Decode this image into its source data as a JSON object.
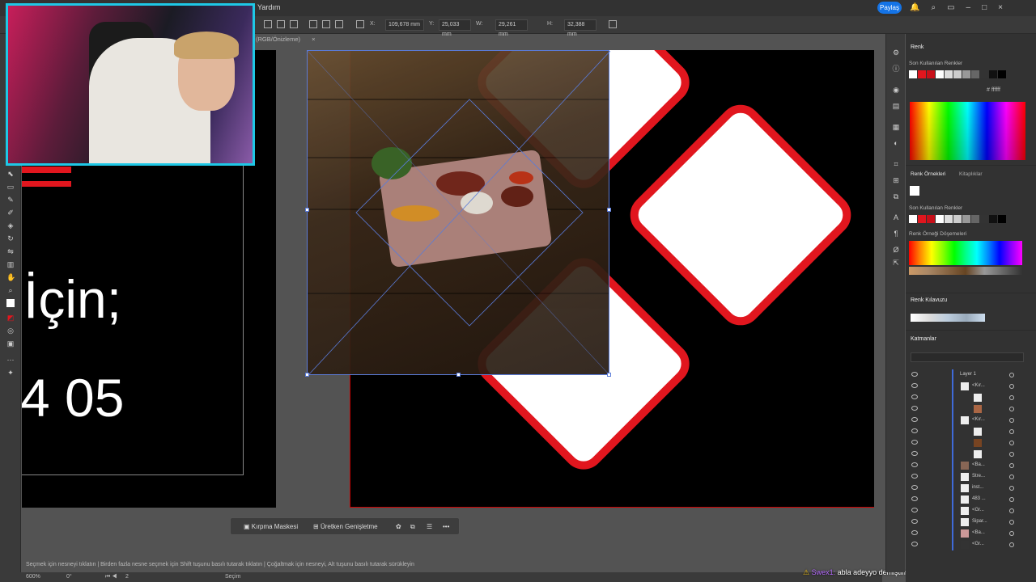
{
  "menubar": {
    "menu_label": "Yardım",
    "share_label": "Paylaş"
  },
  "control": {
    "x_label": "X:",
    "x_value": "109,678 mm",
    "y_label": "Y:",
    "y_value": "25,033 mm",
    "w_label": "W:",
    "w_value": "29,261 mm",
    "h_label": "H:",
    "h_value": "32,388 mm"
  },
  "doc_tab": {
    "label": "(RGB/Önizleme)",
    "close": "×"
  },
  "canvas": {
    "text_line1": "İçin;",
    "text_line2": "4 05"
  },
  "taskbar": {
    "clip_mask": "Kırpma Maskesi",
    "gen_expand": "Üretken Genişletme",
    "more": "•••"
  },
  "status": {
    "hint": "Seçmek için nesneyi tıklatın  |  Birden fazla nesne seçmek için Shift tuşunu basılı tutarak tıklatın  |  Çoğaltmak için nesneyi, Alt tuşunu basılı tutarak sürükleyin",
    "zoom": "600%",
    "rotation": "0°",
    "artboard_num": "2",
    "tool_name": "Seçim"
  },
  "chat": {
    "user": "Swex1:",
    "message": "abla adeyyo demiştim heralde kaydırma oldu"
  },
  "color_panel": {
    "title": "Renk",
    "recent_label": "Son Kullanılan Renkler",
    "hex_label": "#",
    "hex_value": "ffffff"
  },
  "swatches_panel": {
    "tab_active": "Renk Örnekleri",
    "tab_other": "Kitaplıklar",
    "recent_label": "Son Kullanılan Renkler",
    "library_label": "Renk Örneği Döşemeleri"
  },
  "guide_panel": {
    "title": "Renk Kılavuzu"
  },
  "layers_panel": {
    "title": "Katmanlar",
    "search_placeholder": "",
    "rows": [
      {
        "name": "Layer 1"
      },
      {
        "name": "<Kır..."
      },
      {
        "name": ""
      },
      {
        "name": ""
      },
      {
        "name": "<Kır..."
      },
      {
        "name": ""
      },
      {
        "name": ""
      },
      {
        "name": ""
      },
      {
        "name": "<Ba..."
      },
      {
        "name": "Stre..."
      },
      {
        "name": "inst..."
      },
      {
        "name": "483 ..."
      },
      {
        "name": "<Gr..."
      },
      {
        "name": "Sipar..."
      },
      {
        "name": "<Ba..."
      },
      {
        "name": "<Gr..."
      }
    ]
  },
  "colors": {
    "accent": "#1473e6",
    "brand_red": "#e1161e",
    "webcam_border": "#1ec8e6"
  }
}
